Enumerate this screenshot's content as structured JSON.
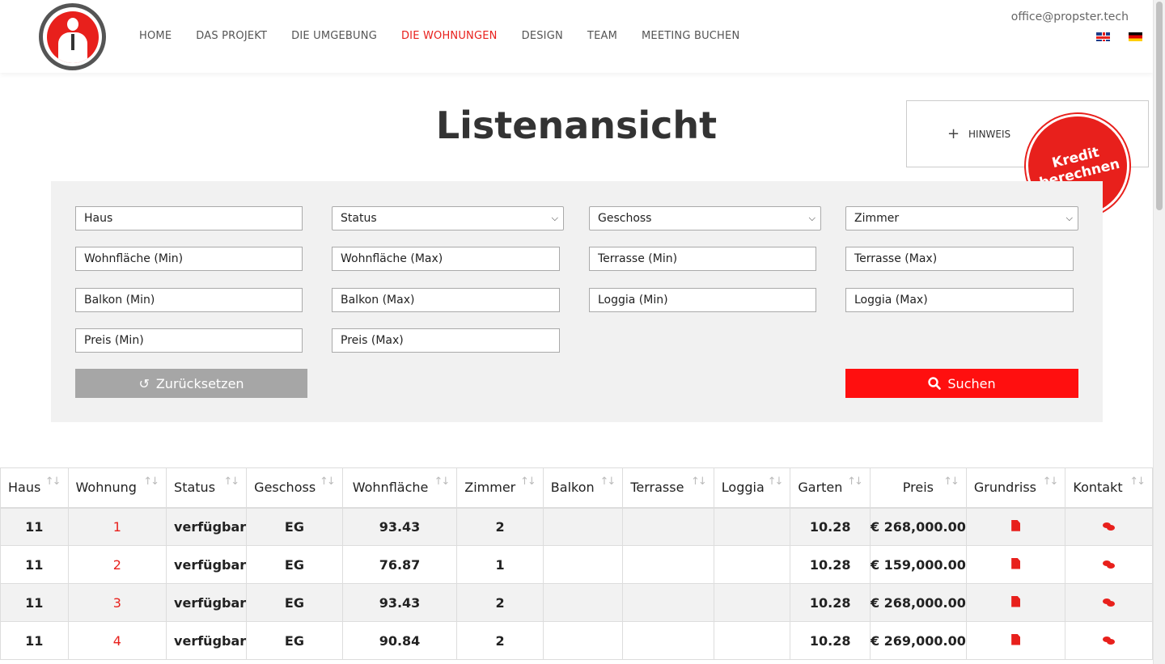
{
  "header": {
    "nav": [
      "HOME",
      "DAS PROJEKT",
      "DIE UMGEBUNG",
      "DIE WOHNUNGEN",
      "DESIGN",
      "TEAM",
      "MEETING BUCHEN"
    ],
    "active_nav": "DIE WOHNUNGEN",
    "email": "office@propster.tech",
    "languages": [
      "English",
      "Deutsch"
    ]
  },
  "page_title": "Listenansicht",
  "hinweis": {
    "label": "HINWEIS",
    "icon": "plus-icon"
  },
  "kredit": {
    "line1": "Kredit",
    "line2": "berechnen"
  },
  "filters": {
    "haus": "Haus",
    "status": "Status",
    "geschoss": "Geschoss",
    "zimmer": "Zimmer",
    "wohnflaeche_min": "Wohnfläche (Min)",
    "wohnflaeche_max": "Wohnfläche (Max)",
    "terrasse_min": "Terrasse (Min)",
    "terrasse_max": "Terrasse (Max)",
    "balkon_min": "Balkon (Min)",
    "balkon_max": "Balkon (Max)",
    "loggia_min": "Loggia (Min)",
    "loggia_max": "Loggia (Max)",
    "preis_min": "Preis (Min)",
    "preis_max": "Preis (Max)",
    "reset_label": "Zurücksetzen",
    "search_label": "Suchen"
  },
  "table": {
    "columns": [
      "Haus",
      "Wohnung",
      "Status",
      "Geschoss",
      "Wohnfläche",
      "Zimmer",
      "Balkon",
      "Terrasse",
      "Loggia",
      "Garten",
      "Preis",
      "Grundriss",
      "Kontakt"
    ],
    "rows": [
      {
        "haus": "11",
        "wohnung": "1",
        "status": "verfügbar",
        "geschoss": "EG",
        "wohnflaeche": "93.43",
        "zimmer": "2",
        "balkon": "",
        "terrasse": "",
        "loggia": "",
        "garten": "10.28",
        "preis": "€ 268,000.00"
      },
      {
        "haus": "11",
        "wohnung": "2",
        "status": "verfügbar",
        "geschoss": "EG",
        "wohnflaeche": "76.87",
        "zimmer": "1",
        "balkon": "",
        "terrasse": "",
        "loggia": "",
        "garten": "10.28",
        "preis": "€ 159,000.00"
      },
      {
        "haus": "11",
        "wohnung": "3",
        "status": "verfügbar",
        "geschoss": "EG",
        "wohnflaeche": "93.43",
        "zimmer": "2",
        "balkon": "",
        "terrasse": "",
        "loggia": "",
        "garten": "10.28",
        "preis": "€ 268,000.00"
      },
      {
        "haus": "11",
        "wohnung": "4",
        "status": "verfügbar",
        "geschoss": "EG",
        "wohnflaeche": "90.84",
        "zimmer": "2",
        "balkon": "",
        "terrasse": "",
        "loggia": "",
        "garten": "10.28",
        "preis": "€ 269,000.00"
      }
    ]
  },
  "colors": {
    "accent": "#e8201c",
    "search_button": "#ff0f0f",
    "reset_button": "#a6a6a6",
    "panel_bg": "#f1f1f1"
  }
}
